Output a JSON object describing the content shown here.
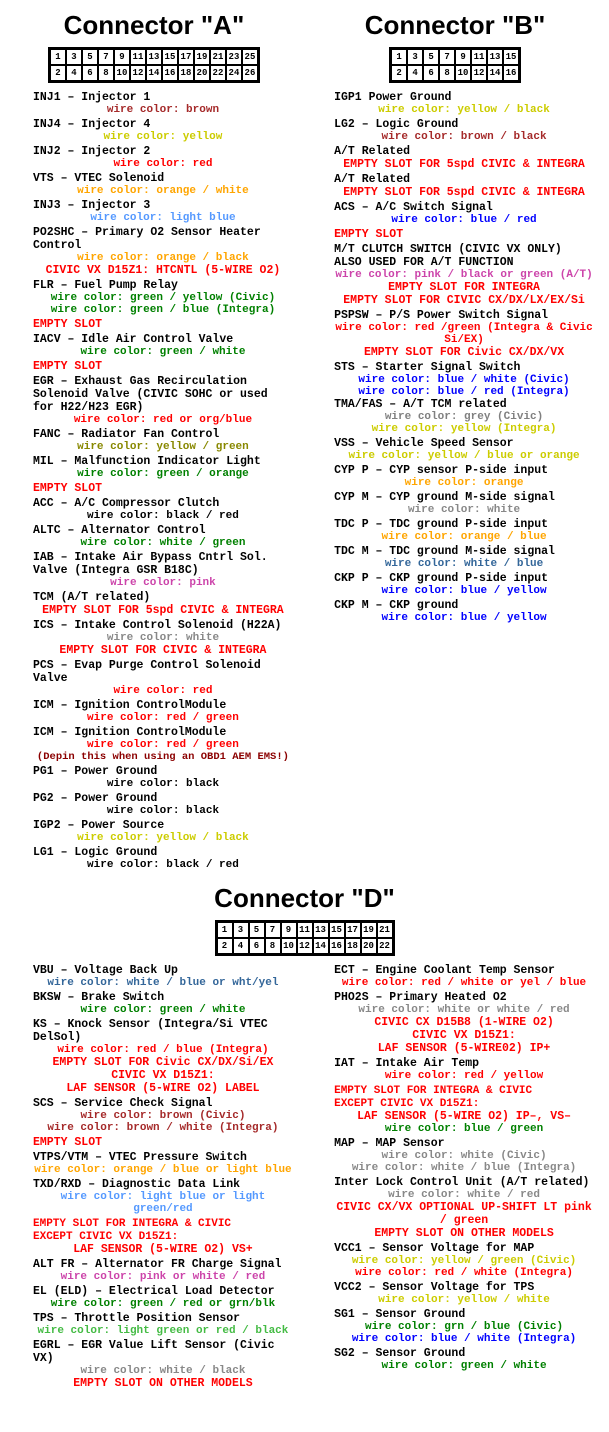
{
  "connectorA": {
    "title": "Connector \"A\"",
    "pinRows": [
      [
        "1",
        "3",
        "5",
        "7",
        "9",
        "11",
        "13",
        "15",
        "17",
        "19",
        "21",
        "23",
        "25"
      ],
      [
        "2",
        "4",
        "6",
        "8",
        "10",
        "12",
        "14",
        "16",
        "18",
        "20",
        "22",
        "24",
        "26"
      ]
    ],
    "pins": [
      {
        "num": "1",
        "name": "INJ1 – Injector 1",
        "wireLabel": "wire color: brown",
        "wireClass": "wire-brown"
      },
      {
        "num": "2",
        "name": "INJ4 – Injector 4",
        "wireLabel": "wire color: yellow",
        "wireClass": "wire-yellow"
      },
      {
        "num": "3",
        "name": "INJ2 – Injector 2",
        "wireLabel": "wire color: red",
        "wireClass": "wire-red"
      },
      {
        "num": "4",
        "name": "VTS – VTEC Solenoid",
        "wireLabel": "wire color: orange / white",
        "wireClass": "wire-orange"
      },
      {
        "num": "5",
        "name": "INJ3 – Injector 3",
        "wireLabel": "wire color: light blue",
        "wireClass": "wire-lightblue"
      },
      {
        "num": "6",
        "name": "PO2SHC – Primary O2 Sensor Heater Control",
        "wireLabel": "wire color: orange / black",
        "wireClass": "wire-orange-black",
        "extra": "CIVIC VX D15Z1: HTCNTL (5-WIRE O2)",
        "extraClass": "wire-civic"
      },
      {
        "num": "7",
        "name": "FLR – Fuel Pump Relay",
        "wireLabel": "wire color: green / yellow (Civic)",
        "wireLabel2": "wire color: green / blue (Integra)",
        "wireClass": "wire-green"
      },
      {
        "num": "8",
        "name": "EMPTY SLOT",
        "empty": true
      },
      {
        "num": "9",
        "name": "IACV – Idle Air Control Valve",
        "wireLabel": "wire color: green / white",
        "wireClass": "wire-green-white"
      },
      {
        "num": "10",
        "name": "EMPTY SLOT",
        "empty": true
      },
      {
        "num": "11",
        "name": "EGR – Exhaust Gas Recirculation Solenoid Valve (CIVIC SOHC or used for H22/H23 EGR)",
        "wireLabel": "wire color: red or org/blue",
        "wireClass": "wire-red"
      },
      {
        "num": "12",
        "name": "FANC – Radiator Fan Control",
        "wireLabel": "wire color: yellow / green",
        "wireClass": "wire-yellow-green"
      },
      {
        "num": "13",
        "name": "MIL – Malfunction Indicator Light",
        "wireLabel": "wire color: green / orange",
        "wireClass": "wire-green"
      },
      {
        "num": "14",
        "name": "EMPTY SLOT",
        "empty": true
      },
      {
        "num": "15",
        "name": "ACC – A/C Compressor Clutch",
        "wireLabel": "wire color: black / red",
        "wireClass": "wire-black"
      },
      {
        "num": "16",
        "name": "ALTC – Alternator Control",
        "wireLabel": "wire color: white / green",
        "wireClass": "wire-white-green"
      },
      {
        "num": "17",
        "name": "IAB – Intake Air Bypass Cntrl Sol. Valve (Integra GSR B18C)",
        "wireLabel": "wire color: pink",
        "wireClass": "wire-pink"
      },
      {
        "num": "18",
        "name": "TCM (A/T related)",
        "extraSlot": "EMPTY SLOT FOR 5spd CIVIC & INTEGRA",
        "extraSlotClass": "empty-slot-text"
      },
      {
        "num": "19",
        "name": "ICS – Intake Control Solenoid (H22A)",
        "wireLabel": "wire color: white",
        "wireClass": "wire-white",
        "extraSlot": "EMPTY SLOT FOR CIVIC & INTEGRA",
        "extraSlotClass": "empty-slot-text"
      },
      {
        "num": "20",
        "name": "PCS – Evap Purge Control Solenoid Valve",
        "wireLabel": "wire color: red",
        "wireClass": "wire-red"
      },
      {
        "num": "21",
        "name": "ICM – Ignition ControlModule",
        "wireLabel": "wire color: red / green",
        "wireClass": "wire-red-green"
      },
      {
        "num": "22",
        "name": "ICM – Ignition ControlModule",
        "wireLabel": "wire color: red / green",
        "wireClass": "wire-red-green",
        "note": "(Depin this when using an OBD1 AEM EMS!)"
      },
      {
        "num": "23",
        "name": "PG1 – Power Ground",
        "wireLabel": "wire color: black",
        "wireClass": "wire-black"
      },
      {
        "num": "24",
        "name": "PG2 – Power Ground",
        "wireLabel": "wire color: black",
        "wireClass": "wire-black"
      },
      {
        "num": "25",
        "name": "IGP2 – Power Source",
        "wireLabel": "wire color: yellow / black",
        "wireClass": "wire-yellow-black"
      },
      {
        "num": "26",
        "name": "LG1 – Logic Ground",
        "wireLabel": "wire color: black / red",
        "wireClass": "wire-black-red2"
      }
    ]
  },
  "connectorB": {
    "title": "Connector \"B\"",
    "pinRows": [
      [
        "1",
        "3",
        "5",
        "7",
        "9",
        "11",
        "13",
        "15"
      ],
      [
        "2",
        "4",
        "6",
        "8",
        "10",
        "12",
        "14",
        "16"
      ]
    ],
    "pins": [
      {
        "num": "1",
        "name": "IGP1 Power Ground",
        "wireLabel": "wire color: yellow / black",
        "wireClass": "wire-yellow-black"
      },
      {
        "num": "2",
        "name": "LG2 – Logic Ground",
        "wireLabel": "wire color: brown / black",
        "wireClass": "wire-brown"
      },
      {
        "num": "3",
        "name": "A/T Related",
        "extraSlot": "EMPTY SLOT FOR 5spd CIVIC & INTEGRA",
        "extraSlotClass": "empty-slot-text"
      },
      {
        "num": "4",
        "name": "A/T Related",
        "extraSlot": "EMPTY SLOT FOR 5spd CIVIC & INTEGRA",
        "extraSlotClass": "empty-slot-text"
      },
      {
        "num": "5",
        "name": "ACS – A/C Switch Signal",
        "wireLabel": "wire color: blue / red",
        "wireClass": "wire-blue"
      },
      {
        "num": "6",
        "name": "EMPTY SLOT",
        "empty": true
      },
      {
        "num": "7",
        "name": "M/T CLUTCH SWITCH (CIVIC VX ONLY) ALSO USED FOR A/T FUNCTION",
        "wireLabel": "wire color: pink / black or green (A/T)",
        "wireClass": "wire-pink",
        "extraSlot": "EMPTY SLOT FOR INTEGRA",
        "extra2": "EMPTY SLOT FOR CIVIC CX/DX/LX/EX/Si",
        "extraSlotClass": "empty-slot-text"
      },
      {
        "num": "8",
        "name": "PSPSW – P/S Power Switch Signal",
        "wireLabel": "wire color: red /green (Integra & Civic Si/EX)",
        "wireClass": "wire-red-green",
        "extraSlot": "EMPTY SLOT FOR Civic CX/DX/VX",
        "extraSlotClass": "empty-slot-text"
      },
      {
        "num": "9",
        "name": "STS – Starter Signal Switch",
        "wireLabel": "wire color: blue / white (Civic)",
        "wireLabel2": "wire color: blue / red (Integra)",
        "wireClass": "wire-blue",
        "tmafas": "TMA/FAS – A/T TCM related",
        "tmaWire1": "wire color: grey (Civic)",
        "tmaWire2": "wire color: yellow (Integra)"
      },
      {
        "num": "10",
        "name": "VSS – Vehicle Speed Sensor",
        "wireLabel": "wire color: yellow / blue or orange",
        "wireClass": "wire-yellow"
      },
      {
        "num": "11",
        "name": "CYP P – CYP sensor P-side input",
        "wireLabel": "wire color: orange",
        "wireClass": "wire-orange"
      },
      {
        "num": "12",
        "name": "CYP M – CYP ground M-side signal",
        "wireLabel": "wire color: white",
        "wireClass": "wire-white"
      },
      {
        "num": "13",
        "name": "TDC P – TDC ground P-side input",
        "wireLabel": "wire color: orange / blue",
        "wireClass": "wire-orange"
      },
      {
        "num": "14",
        "name": "TDC M – TDC ground M-side signal",
        "wireLabel": "wire color: white / blue",
        "wireClass": "wire-white-blue"
      },
      {
        "num": "15",
        "name": "CKP P – CKP ground P-side input",
        "wireLabel": "wire color: blue / yellow",
        "wireClass": "wire-blue-yellow"
      },
      {
        "num": "16",
        "name": "CKP M – CKP ground",
        "wireLabel": "wire color: blue / yellow",
        "wireClass": "wire-blue-yellow"
      }
    ]
  },
  "connectorD": {
    "title": "Connector \"D\"",
    "pinRows": [
      [
        "1",
        "3",
        "5",
        "7",
        "9",
        "11",
        "13",
        "15",
        "17",
        "19",
        "21"
      ],
      [
        "2",
        "4",
        "6",
        "8",
        "10",
        "12",
        "14",
        "16",
        "18",
        "20",
        "22"
      ]
    ],
    "pinsLeft": [
      {
        "num": "1",
        "name": "VBU – Voltage Back Up",
        "wireLabel": "wire color: white / blue or wht/yel",
        "wireClass": "wire-white-blue"
      },
      {
        "num": "2",
        "name": "BKSW – Brake Switch",
        "wireLabel": "wire color: green / white",
        "wireClass": "wire-green-white"
      },
      {
        "num": "3",
        "name": "KS – Knock Sensor (Integra/Si VTEC DelSol)",
        "wireLabel": "wire color: red / blue (Integra)",
        "wireClass": "wire-red-blue",
        "extraSlot": "EMPTY SLOT FOR Civic CX/DX/Si/EX",
        "extra2": "CIVIC VX D15Z1:",
        "extra3": "LAF SENSOR (5-WIRE O2) LABEL",
        "extraSlotClass": "empty-slot-text"
      },
      {
        "num": "4",
        "name": "SCS – Service Check Signal",
        "wireLabel": "wire color: brown (Civic)",
        "wireLabel2": "wire color: brown / white (Integra)",
        "wireClass": "wire-brown"
      },
      {
        "num": "5",
        "name": "EMPTY SLOT",
        "empty": true
      },
      {
        "num": "6",
        "name": "VTPS/VTM – VTEC Pressure Switch",
        "wireLabel": "wire color: orange / blue or light blue",
        "wireClass": "wire-orange"
      },
      {
        "num": "7",
        "name": "TXD/RXD – Diagnostic Data Link",
        "wireLabel": "wire color: light blue or light green/red",
        "wireClass": "wire-lightblue"
      },
      {
        "num": "8",
        "name": "EMPTY SLOT FOR INTEGRA & CIVIC EXCEPT CIVIC VX D15Z1:",
        "empty": true,
        "extraSlot": "LAF SENSOR (5-WIRE O2) VS+",
        "extraSlotClass": "empty-slot-text"
      },
      {
        "num": "9",
        "name": "ALT FR – Alternator FR Charge Signal",
        "wireLabel": "wire color: pink or white / red",
        "wireClass": "wire-pink"
      },
      {
        "num": "10",
        "name": "EL (ELD) – Electrical Load Detector",
        "wireLabel": "wire color: green / red or grn/blk",
        "wireClass": "wire-green-red"
      },
      {
        "num": "11",
        "name": "TPS – Throttle Position Sensor",
        "wireLabel": "wire color: light green or red / black",
        "wireClass": "wire-lightgreen"
      },
      {
        "num": "12",
        "name": "EGRL – EGR Value Lift Sensor (Civic VX)",
        "wireLabel": "wire color: white / black",
        "wireClass": "wire-white",
        "extraSlot": "EMPTY SLOT ON OTHER MODELS",
        "extraSlotClass": "empty-slot-text"
      }
    ],
    "pinsRight": [
      {
        "num": "13",
        "name": "ECT – Engine Coolant Temp Sensor",
        "wireLabel": "wire color: red / white or yel / blue",
        "wireClass": "wire-red"
      },
      {
        "num": "14",
        "name": "PHO2S – Primary Heated O2",
        "wireLabel": "wire color: white or white / red",
        "wireClass": "wire-white",
        "extra": "CIVIC CX D15B8 (1-WIRE O2)",
        "extra2": "CIVIC VX D15Z1:",
        "extra3": "LAF SENSOR (5-WIRE02) IP+",
        "extraClass": "wire-civic"
      },
      {
        "num": "15",
        "name": "IAT – Intake Air Temp",
        "wireLabel": "wire color: red / yellow",
        "wireClass": "wire-red"
      },
      {
        "num": "16",
        "name": "EMPTY SLOT FOR INTEGRA & CIVIC EXCEPT CIVIC VX D15Z1:",
        "empty": true,
        "extraSlot": "LAF SENSOR (5-WIRE O2) IP–, VS–",
        "extra2": "wire color: blue / green",
        "extraSlotClass": "empty-slot-text"
      },
      {
        "num": "17",
        "name": "MAP – MAP Sensor",
        "wireLabel": "wire color: white (Civic)",
        "wireLabel2": "wire color: white / blue (Integra)",
        "wireClass": "wire-white"
      },
      {
        "num": "18",
        "name": "Inter Lock Control Unit (A/T related)",
        "wireLabel": "wire color: white / red",
        "wireClass": "wire-white",
        "extra": "CIVIC CX/VX OPTIONAL UP-SHIFT LT  pink / green",
        "extra2": "EMPTY SLOT ON OTHER MODELS",
        "extraClass": "wire-civic"
      },
      {
        "num": "19",
        "name": "VCC1 – Sensor Voltage for MAP",
        "wireLabel": "wire color: yellow / green (Civic)",
        "wireLabel2": "wire color: red / white (Integra)",
        "wireClass": "wire-yellow"
      },
      {
        "num": "20",
        "name": "VCC2 – Sensor Voltage for TPS",
        "wireLabel": "wire color: yellow / white",
        "wireClass": "wire-yellow"
      },
      {
        "num": "21",
        "name": "SG1 – Sensor Ground",
        "wireLabel": "wire color: grn / blue (Civic)",
        "wireLabel2": "wire color: blue / white (Integra)",
        "wireClass": "wire-grn-blue"
      },
      {
        "num": "22",
        "name": "SG2 – Sensor Ground",
        "wireLabel": "wire color: green / white",
        "wireClass": "wire-green-white"
      }
    ]
  }
}
